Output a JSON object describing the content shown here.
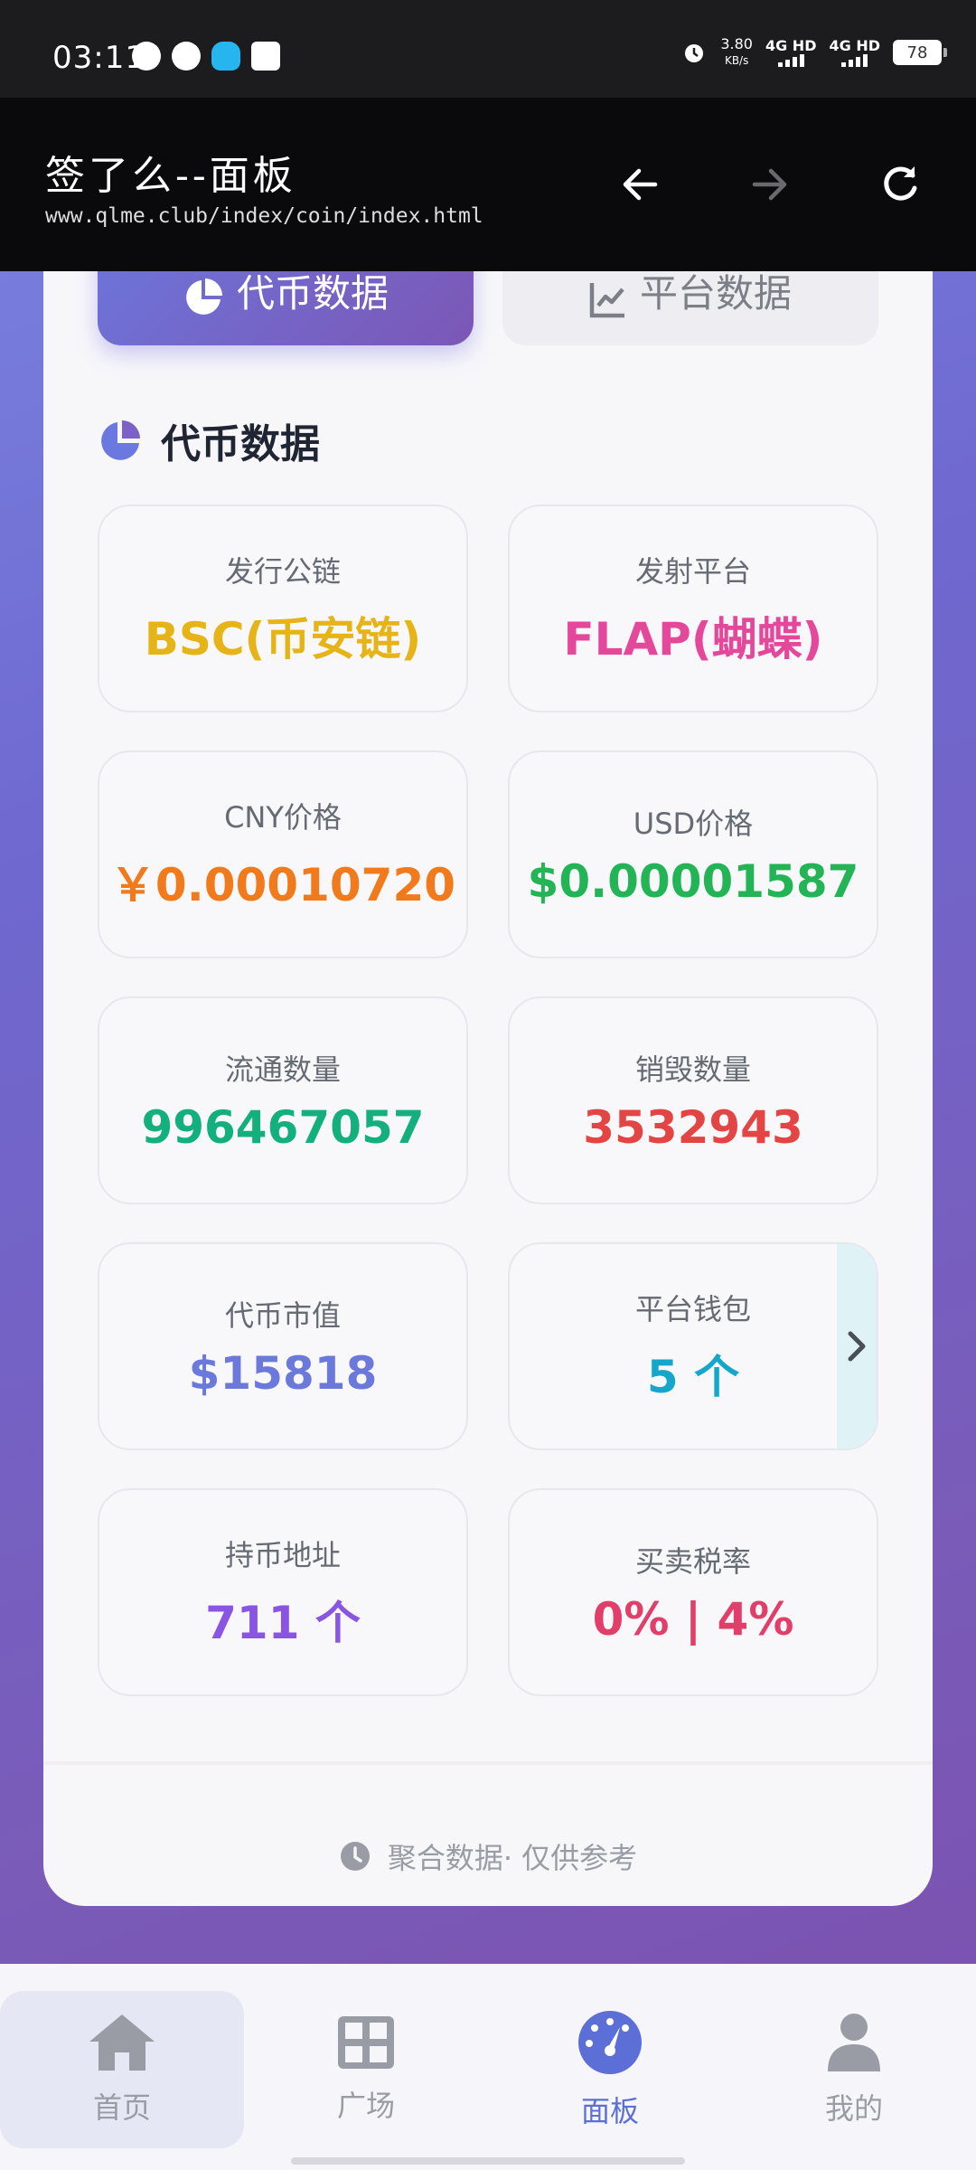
{
  "status_bar": {
    "time": "03:11",
    "net_speed_value": "3.80",
    "net_speed_unit": "KB/s",
    "signal1": "4G HD",
    "signal2": "4G HD",
    "battery": "78"
  },
  "browser": {
    "title": "签了么--面板",
    "url": "www.qlme.club/index/coin/index.html"
  },
  "tabs": [
    {
      "label": "代币数据",
      "active": true
    },
    {
      "label": "平台数据",
      "active": false
    }
  ],
  "section": {
    "title": "代币数据"
  },
  "tiles": [
    {
      "label": "发行公链",
      "value": "BSC(币安链)",
      "color": "#e7b418"
    },
    {
      "label": "发射平台",
      "value": "FLAP(蝴蝶)",
      "color": "#e4489a"
    },
    {
      "label": "CNY价格",
      "value": "￥0.00010720",
      "color": "#f17a1d"
    },
    {
      "label": "USD价格",
      "value": "$0.00001587",
      "color": "#22b455"
    },
    {
      "label": "流通数量",
      "value": "996467057",
      "color": "#14b07b"
    },
    {
      "label": "销毁数量",
      "value": "3532943",
      "color": "#e34545"
    },
    {
      "label": "代币市值",
      "value": "$15818",
      "color": "#6a79da"
    },
    {
      "label": "平台钱包",
      "value": "5 个",
      "color": "#15a7c9"
    },
    {
      "label": "持币地址",
      "value": "711 个",
      "color": "#8a55e2"
    },
    {
      "label": "买卖税率",
      "value": "0% | 4%",
      "color": "#e23e6a"
    }
  ],
  "footer": {
    "note": "聚合数据· 仅供参考"
  },
  "bottom_nav": [
    {
      "label": "首页",
      "icon": "home-icon"
    },
    {
      "label": "广场",
      "icon": "grid-icon"
    },
    {
      "label": "面板",
      "icon": "dashboard-icon",
      "active": true
    },
    {
      "label": "我的",
      "icon": "user-icon"
    }
  ]
}
